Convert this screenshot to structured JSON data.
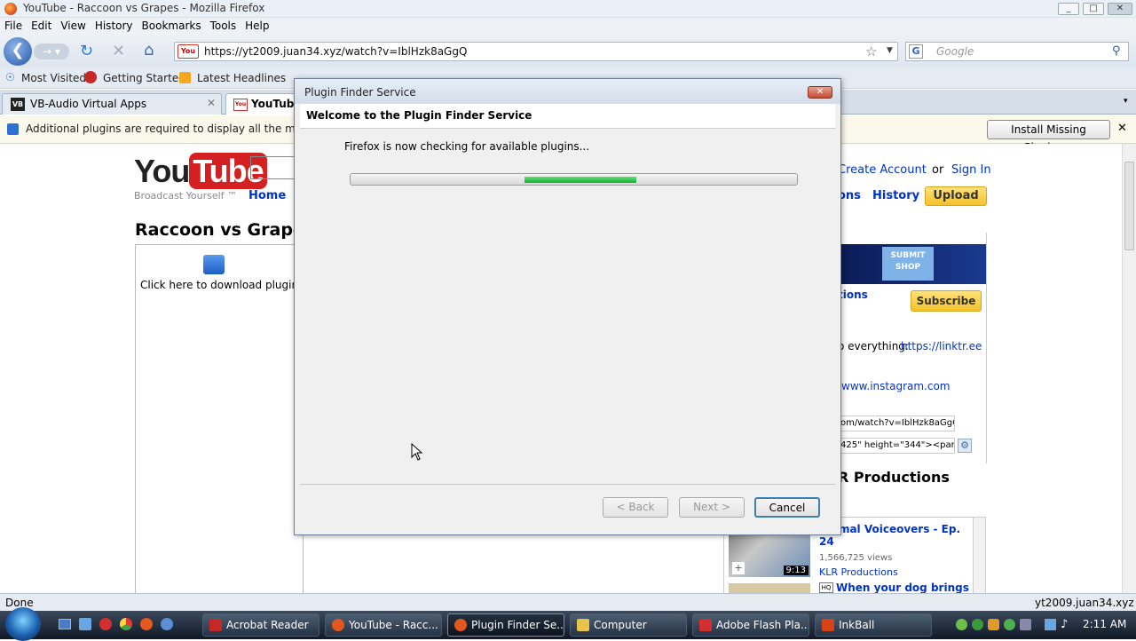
{
  "window": {
    "title": "YouTube - Raccoon vs Grapes - Mozilla Firefox"
  },
  "menu": [
    "File",
    "Edit",
    "View",
    "History",
    "Bookmarks",
    "Tools",
    "Help"
  ],
  "navbar": {
    "url": "https://yt2009.juan34.xyz/watch?v=IblHzk8aGgQ",
    "search_placeholder": "Google"
  },
  "bookmarks": [
    "Most Visited",
    "Getting Started",
    "Latest Headlines"
  ],
  "tabs": [
    {
      "label": "VB-Audio Virtual Apps"
    },
    {
      "label": "YouTube - Raccoon vs Grapes"
    }
  ],
  "notification": {
    "message": "Additional plugins are required to display all the media on this page.",
    "install_label": "Install Missing Plugins..."
  },
  "page": {
    "logo_you": "You",
    "logo_tube": "Tube",
    "tagline": "Broadcast Yourself ™",
    "home": "Home",
    "video_title": "Raccoon vs Grapes",
    "plugin_text": "Click here to download plugin.",
    "create_account": "Create Account",
    "or": "or",
    "sign_in": "Sign In",
    "subscriptions": "ons",
    "history": "History",
    "upload": "Upload",
    "ad": {
      "line1": "SUBMIT",
      "line2": "SHOP"
    },
    "channel_partial": "tions",
    "subscribe": "Subscribe",
    "desc_prefix": "o everything: ",
    "desc_link1": "https://linktr.ee",
    "desc_link2": "/www.instagram.com",
    "url_field": "om/watch?v=IblHzk8aGgQ",
    "embed_field": "425\" height=\"344\"><param",
    "more_from": "R Productions",
    "related": [
      {
        "title": "Animal Voiceovers - Ep. 24",
        "views": "1,566,725 views",
        "channel": "KLR Productions",
        "duration": "9:13"
      },
      {
        "title": "When your dog brings"
      }
    ]
  },
  "dialog": {
    "title": "Plugin Finder Service",
    "header": "Welcome to the Plugin Finder Service",
    "status": "Firefox is now checking for available plugins...",
    "progress_segment": {
      "start": 0.39,
      "end": 0.64
    },
    "back": "< Back",
    "next": "Next >",
    "cancel": "Cancel"
  },
  "statusbar": {
    "left": "Done",
    "right": "yt2009.juan34.xyz"
  },
  "taskbar": {
    "tasks": [
      {
        "label": "Acrobat Reader",
        "color": "#c62828"
      },
      {
        "label": "YouTube - Racc...",
        "color": "#e4571e"
      },
      {
        "label": "Plugin Finder Se...",
        "color": "#e4571e"
      },
      {
        "label": "Computer",
        "color": "#e8c547"
      },
      {
        "label": "Adobe Flash Pla...",
        "color": "#d32f2f"
      },
      {
        "label": "InkBall",
        "color": "#d84315"
      }
    ],
    "clock": "2:11 AM"
  }
}
